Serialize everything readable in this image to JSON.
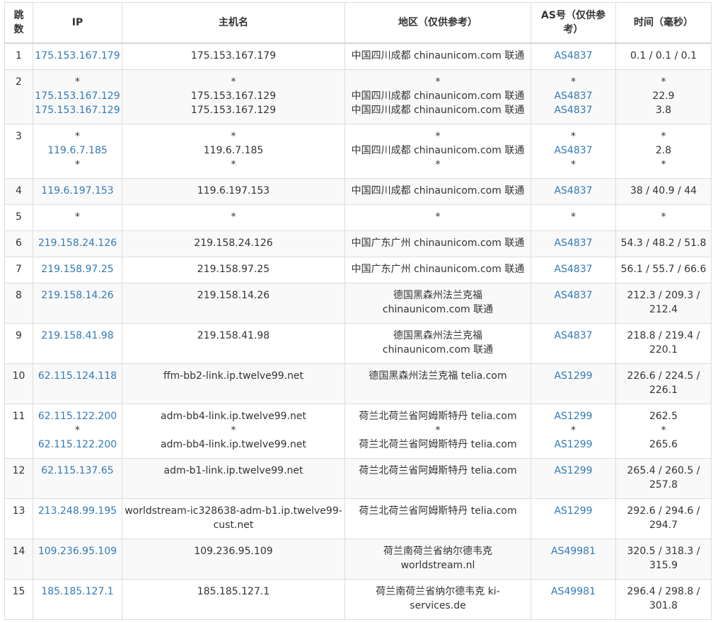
{
  "headers": {
    "hop": "跳数",
    "ip": "IP",
    "hostname": "主机名",
    "location": "地区（仅供参考）",
    "asn": "AS号（仅供参考）",
    "time": "时间（毫秒）"
  },
  "rows": [
    {
      "hop": "1",
      "ip": [
        "175.153.167.179"
      ],
      "host": [
        "175.153.167.179"
      ],
      "loc": [
        "中国四川成都 chinaunicom.com 联通"
      ],
      "asn": [
        "AS4837"
      ],
      "time": [
        "0.1 / 0.1 / 0.1"
      ]
    },
    {
      "hop": "2",
      "ip": [
        "*",
        "175.153.167.129",
        "175.153.167.129"
      ],
      "host": [
        "*",
        "175.153.167.129",
        "175.153.167.129"
      ],
      "loc": [
        "*",
        "中国四川成都 chinaunicom.com 联通",
        "中国四川成都 chinaunicom.com 联通"
      ],
      "asn": [
        "*",
        "AS4837",
        "AS4837"
      ],
      "time": [
        "*",
        "22.9",
        "3.8"
      ]
    },
    {
      "hop": "3",
      "ip": [
        "*",
        "119.6.7.185",
        "*"
      ],
      "host": [
        "*",
        "119.6.7.185",
        "*"
      ],
      "loc": [
        "*",
        "中国四川成都 chinaunicom.com 联通",
        "*"
      ],
      "asn": [
        "*",
        "AS4837",
        "*"
      ],
      "time": [
        "*",
        "2.8",
        "*"
      ]
    },
    {
      "hop": "4",
      "ip": [
        "119.6.197.153"
      ],
      "host": [
        "119.6.197.153"
      ],
      "loc": [
        "中国四川成都 chinaunicom.com 联通"
      ],
      "asn": [
        "AS4837"
      ],
      "time": [
        "38 / 40.9 / 44"
      ]
    },
    {
      "hop": "5",
      "ip": [
        "*"
      ],
      "host": [
        "*"
      ],
      "loc": [
        "*"
      ],
      "asn": [
        "*"
      ],
      "time": [
        "*"
      ]
    },
    {
      "hop": "6",
      "ip": [
        "219.158.24.126"
      ],
      "host": [
        "219.158.24.126"
      ],
      "loc": [
        "中国广东广州 chinaunicom.com 联通"
      ],
      "asn": [
        "AS4837"
      ],
      "time": [
        "54.3 / 48.2 / 51.8"
      ]
    },
    {
      "hop": "7",
      "ip": [
        "219.158.97.25"
      ],
      "host": [
        "219.158.97.25"
      ],
      "loc": [
        "中国广东广州 chinaunicom.com 联通"
      ],
      "asn": [
        "AS4837"
      ],
      "time": [
        "56.1 / 55.7 / 66.6"
      ]
    },
    {
      "hop": "8",
      "ip": [
        "219.158.14.26"
      ],
      "host": [
        "219.158.14.26"
      ],
      "loc": [
        "德国黑森州法兰克福",
        "chinaunicom.com 联通"
      ],
      "asn": [
        "AS4837"
      ],
      "time": [
        "212.3 / 209.3 /",
        "212.4"
      ]
    },
    {
      "hop": "9",
      "ip": [
        "219.158.41.98"
      ],
      "host": [
        "219.158.41.98"
      ],
      "loc": [
        "德国黑森州法兰克福",
        "chinaunicom.com 联通"
      ],
      "asn": [
        "AS4837"
      ],
      "time": [
        "218.8 / 219.4 /",
        "220.1"
      ]
    },
    {
      "hop": "10",
      "ip": [
        "62.115.124.118"
      ],
      "host": [
        "ffm-bb2-link.ip.twelve99.net"
      ],
      "loc": [
        "德国黑森州法兰克福 telia.com"
      ],
      "asn": [
        "AS1299"
      ],
      "time": [
        "226.6 / 224.5 /",
        "226.1"
      ]
    },
    {
      "hop": "11",
      "ip": [
        "62.115.122.200",
        "*",
        "62.115.122.200"
      ],
      "host": [
        "adm-bb4-link.ip.twelve99.net",
        "*",
        "adm-bb4-link.ip.twelve99.net"
      ],
      "loc": [
        "荷兰北荷兰省阿姆斯特丹 telia.com",
        "*",
        "荷兰北荷兰省阿姆斯特丹 telia.com"
      ],
      "asn": [
        "AS1299",
        "*",
        "AS1299"
      ],
      "time": [
        "262.5",
        "*",
        "265.6"
      ]
    },
    {
      "hop": "12",
      "ip": [
        "62.115.137.65"
      ],
      "host": [
        "adm-b1-link.ip.twelve99.net"
      ],
      "loc": [
        "荷兰北荷兰省阿姆斯特丹 telia.com"
      ],
      "asn": [
        "AS1299"
      ],
      "time": [
        "265.4 / 260.5 /",
        "257.8"
      ]
    },
    {
      "hop": "13",
      "ip": [
        "213.248.99.195"
      ],
      "host": [
        "worldstream-ic328638-adm-b1.ip.twelve99-",
        "cust.net"
      ],
      "loc": [
        "荷兰北荷兰省阿姆斯特丹 telia.com"
      ],
      "asn": [
        "AS1299"
      ],
      "time": [
        "292.6 / 294.6 /",
        "294.7"
      ]
    },
    {
      "hop": "14",
      "ip": [
        "109.236.95.109"
      ],
      "host": [
        "109.236.95.109"
      ],
      "loc": [
        "荷兰南荷兰省纳尔德韦克",
        "worldstream.nl"
      ],
      "asn": [
        "AS49981"
      ],
      "time": [
        "320.5 / 318.3 /",
        "315.9"
      ]
    },
    {
      "hop": "15",
      "ip": [
        "185.185.127.1"
      ],
      "host": [
        "185.185.127.1"
      ],
      "loc": [
        "荷兰南荷兰省纳尔德韦克 ki-",
        "services.de"
      ],
      "asn": [
        "AS49981"
      ],
      "time": [
        "296.4 / 298.8 /",
        "301.8"
      ]
    }
  ],
  "colors": {
    "link": "#337ab7",
    "text": "#333333",
    "border": "#dddddd",
    "stripe": "#f9f9f9"
  }
}
